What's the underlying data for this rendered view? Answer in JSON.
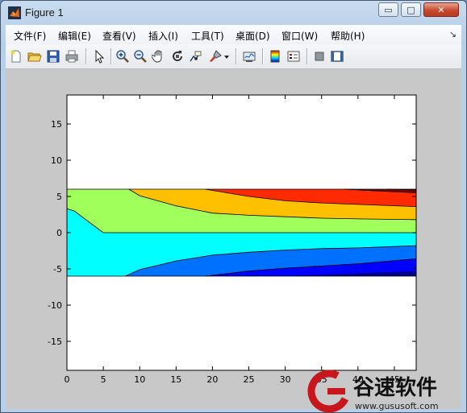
{
  "window": {
    "title": "Figure 1"
  },
  "caption_buttons": {
    "minimize": "▭",
    "maximize": "□",
    "close": "✕"
  },
  "menu": {
    "items": [
      "文件(F)",
      "编辑(E)",
      "查看(V)",
      "插入(I)",
      "工具(T)",
      "桌面(D)",
      "窗口(W)",
      "帮助(H)"
    ],
    "overflow": "↘"
  },
  "toolbar": {
    "icons": [
      "new-figure-icon",
      "open-file-icon",
      "save-icon",
      "print-icon",
      "pointer-icon",
      "zoom-in-icon",
      "zoom-out-icon",
      "pan-hand-icon",
      "rotate-3d-icon",
      "data-cursor-icon",
      "brush-icon",
      "brush-dropdown-icon",
      "link-plot-icon",
      "colorbar-icon",
      "legend-icon",
      "hide-plot-tools-icon",
      "show-plot-tools-icon"
    ]
  },
  "chart_data": {
    "type": "contour",
    "title": "",
    "xlabel": "",
    "ylabel": "",
    "xlim": [
      0,
      48
    ],
    "ylim": [
      -19,
      19
    ],
    "xticks": [
      0,
      5,
      10,
      15,
      20,
      25,
      30,
      35,
      40,
      45
    ],
    "yticks": [
      15,
      10,
      5,
      0,
      -5,
      -10,
      -15
    ],
    "xtick_labels": [
      "0",
      "5",
      "10",
      "15",
      "20",
      "25",
      "30",
      "35",
      "40",
      "45"
    ],
    "ytick_labels": [
      "15",
      "10",
      "5",
      "0",
      "-5",
      "-10",
      "-15"
    ],
    "colormap": "jet",
    "domain": {
      "x": [
        0,
        48
      ],
      "y": [
        -6,
        6
      ]
    },
    "levels": [
      {
        "color": "#00008f",
        "upper": [
          [
            0,
            -6
          ],
          [
            48,
            -6
          ]
        ],
        "lower": null
      },
      {
        "color": "#0000ff",
        "boundary": [
          [
            19,
            -6
          ],
          [
            25,
            -5.3
          ],
          [
            30,
            -4.9
          ],
          [
            35,
            -4.6
          ],
          [
            40,
            -4.3
          ],
          [
            48,
            -3.6
          ]
        ]
      },
      {
        "color": "#0070ff",
        "boundary": [
          [
            8,
            -6
          ],
          [
            10,
            -5.1
          ],
          [
            15,
            -3.9
          ],
          [
            20,
            -3.1
          ],
          [
            25,
            -2.7
          ],
          [
            30,
            -2.4
          ],
          [
            35,
            -2.2
          ],
          [
            40,
            -2.1
          ],
          [
            48,
            -1.8
          ]
        ]
      },
      {
        "color": "#00ffff",
        "boundary": [
          [
            5,
            0
          ],
          [
            48,
            0
          ]
        ]
      },
      {
        "color": "#a0ff5a",
        "boundary": [
          [
            8.5,
            6
          ],
          [
            10,
            5.1
          ],
          [
            15,
            3.7
          ],
          [
            20,
            2.7
          ],
          [
            25,
            2.4
          ],
          [
            30,
            2.2
          ],
          [
            35,
            2.0
          ],
          [
            40,
            1.9
          ],
          [
            48,
            1.8
          ]
        ]
      },
      {
        "color": "#ffc000",
        "boundary": [
          [
            19,
            6
          ],
          [
            25,
            5.0
          ],
          [
            30,
            4.4
          ],
          [
            35,
            4.1
          ],
          [
            40,
            3.9
          ],
          [
            48,
            3.6
          ]
        ]
      },
      {
        "color": "#ff2a00",
        "boundary": [
          [
            38,
            6
          ],
          [
            42,
            5.8
          ],
          [
            48,
            5.5
          ]
        ]
      },
      {
        "color": "#7f0000",
        "boundary": [
          [
            44,
            6
          ],
          [
            48,
            5.9
          ]
        ]
      }
    ]
  },
  "watermark": {
    "text": "谷速软件",
    "url": "www.gususoft.com"
  }
}
